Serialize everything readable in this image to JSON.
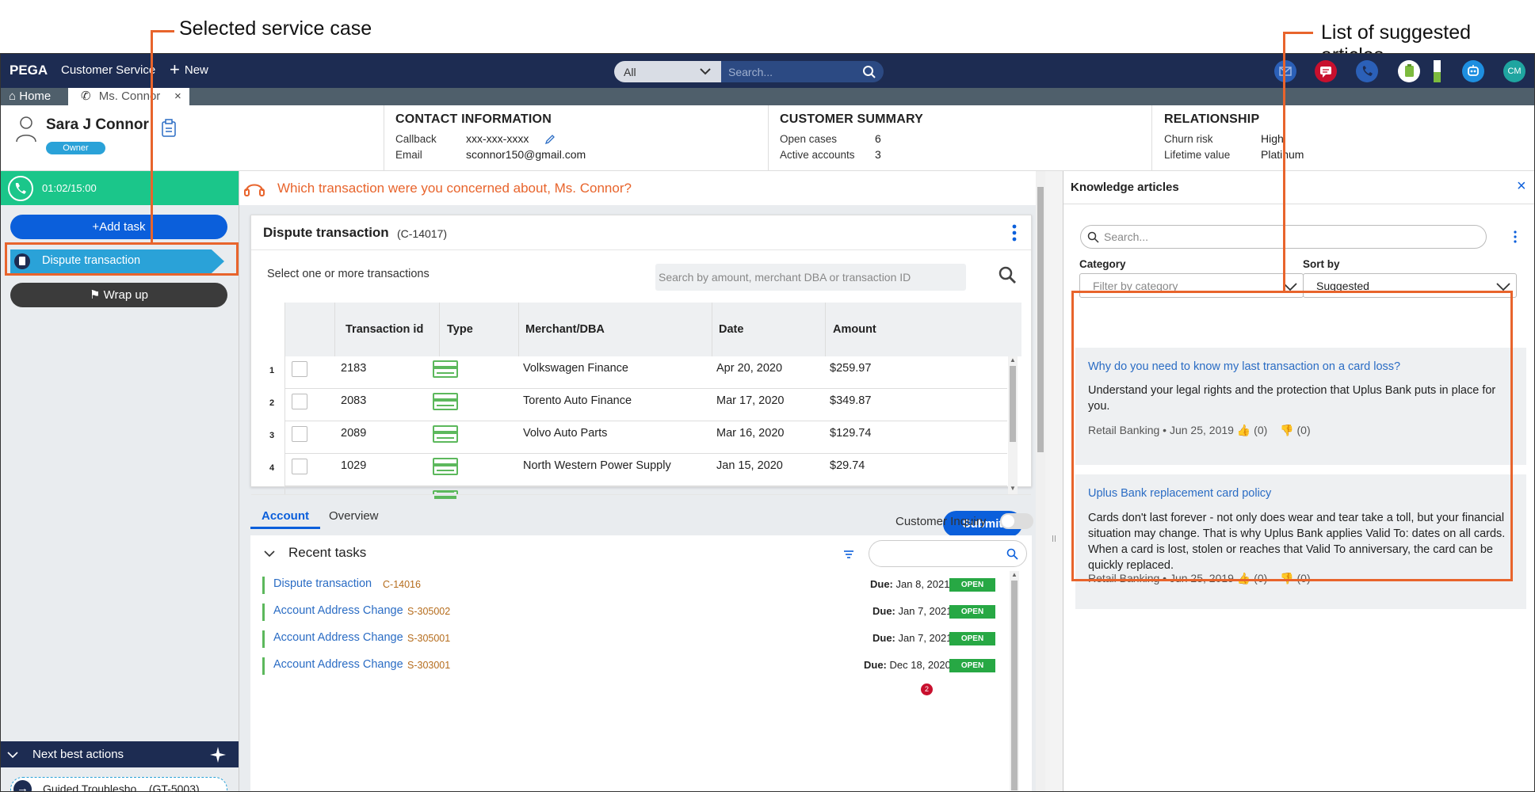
{
  "callouts": {
    "left": "Selected service case",
    "right": "List of suggested articles"
  },
  "topbar": {
    "brand": "PEGA",
    "app_name": "Customer Service",
    "new_label": "New",
    "search_scope": "All",
    "search_placeholder": "Search...",
    "avatar_initials": "CM"
  },
  "tabs": {
    "home": "Home",
    "interaction": "Ms. Connor"
  },
  "customer": {
    "name": "Sara J Connor",
    "role_badge": "Owner"
  },
  "contact": {
    "title": "CONTACT INFORMATION",
    "callback_label": "Callback",
    "callback_value": "xxx-xxx-xxxx",
    "email_label": "Email",
    "email_value": "sconnor150@gmail.com"
  },
  "summary": {
    "title": "CUSTOMER SUMMARY",
    "open_cases_label": "Open cases",
    "open_cases_value": "6",
    "active_accounts_label": "Active accounts",
    "active_accounts_value": "3"
  },
  "relationship": {
    "title": "RELATIONSHIP",
    "churn_label": "Churn risk",
    "churn_value": "High",
    "lifetime_label": "Lifetime value",
    "lifetime_value": "Platinum"
  },
  "leftpane": {
    "timer": "01:02/15:00",
    "add_task": "Add task",
    "case_label": "Dispute transaction",
    "wrap_up": "Wrap up",
    "nba_title": "Next best actions",
    "nba_item": "Guided Troublesho... (GT-5003)"
  },
  "script_prompt": "Which transaction were you concerned about,  Ms. Connor?",
  "dispute": {
    "title": "Dispute transaction",
    "case_id": "(C-14017)",
    "instruction": "Select one or more transactions",
    "search_placeholder": "Search by amount, merchant DBA or transaction ID",
    "columns": [
      "Transaction id",
      "Type",
      "Merchant/DBA",
      "Date",
      "Amount"
    ],
    "rows": [
      {
        "num": "1",
        "id": "2183",
        "merchant": "Volkswagen Finance",
        "date": "Apr 20, 2020",
        "amount": "$259.97"
      },
      {
        "num": "2",
        "id": "2083",
        "merchant": "Torento Auto Finance",
        "date": "Mar 17, 2020",
        "amount": "$349.87"
      },
      {
        "num": "3",
        "id": "2089",
        "merchant": "Volvo Auto Parts",
        "date": "Mar 16, 2020",
        "amount": "$129.74"
      },
      {
        "num": "4",
        "id": "1029",
        "merchant": "North Western Power Supply",
        "date": "Jan 15, 2020",
        "amount": "$29.74"
      }
    ],
    "submit": "Submit"
  },
  "lower": {
    "tab_account": "Account",
    "tab_overview": "Overview",
    "inquiry_label": "Customer Inquiry",
    "recent_title": "Recent tasks",
    "tasks": [
      {
        "name": "Dispute transaction",
        "id": "C-14016",
        "due_label": "Due:",
        "due": "Jan 8, 2021",
        "status": "OPEN"
      },
      {
        "name": "Account Address Change",
        "id": "S-305002",
        "due_label": "Due:",
        "due": "Jan 7, 2021",
        "status": "OPEN"
      },
      {
        "name": "Account Address Change",
        "id": "S-305001",
        "due_label": "Due:",
        "due": "Jan 7, 2021",
        "status": "OPEN"
      },
      {
        "name": "Account Address Change",
        "id": "S-303001",
        "due_label": "Due:",
        "due": "Dec 18, 2020",
        "status": "OPEN"
      }
    ],
    "notif_count": "2"
  },
  "knowledge": {
    "title": "Knowledge articles",
    "search_placeholder": "Search...",
    "category_label": "Category",
    "category_placeholder": "Filter by category",
    "sort_label": "Sort by",
    "sort_value": "Suggested",
    "articles": [
      {
        "title": "Why do you need to know my last transaction on a card loss?",
        "body": "Understand your legal rights and the protection that Uplus Bank puts in place for you.",
        "source": "Retail Banking",
        "date": "Jun 25, 2019",
        "likes": "(0)",
        "dislikes": "(0)"
      },
      {
        "title": "Uplus Bank replacement card policy",
        "body": "Cards don't last forever - not only does wear and tear take a toll, but your financial situation may change. That is why Uplus Bank applies Valid To: dates on all cards. When a card is lost, stolen or reaches that Valid To anniversary, the card can be quickly replaced.",
        "source": "Retail Banking",
        "date": "Jun 25, 2019",
        "likes": "(0)",
        "dislikes": "(0)"
      }
    ]
  },
  "colors": {
    "nav": "#1d2c52",
    "accent_green": "#1bc68a",
    "case_blue": "#2aa2d8",
    "primary_button": "#0b5fdb",
    "callout_orange": "#e8642c",
    "prompt_orange": "#e8642c"
  }
}
